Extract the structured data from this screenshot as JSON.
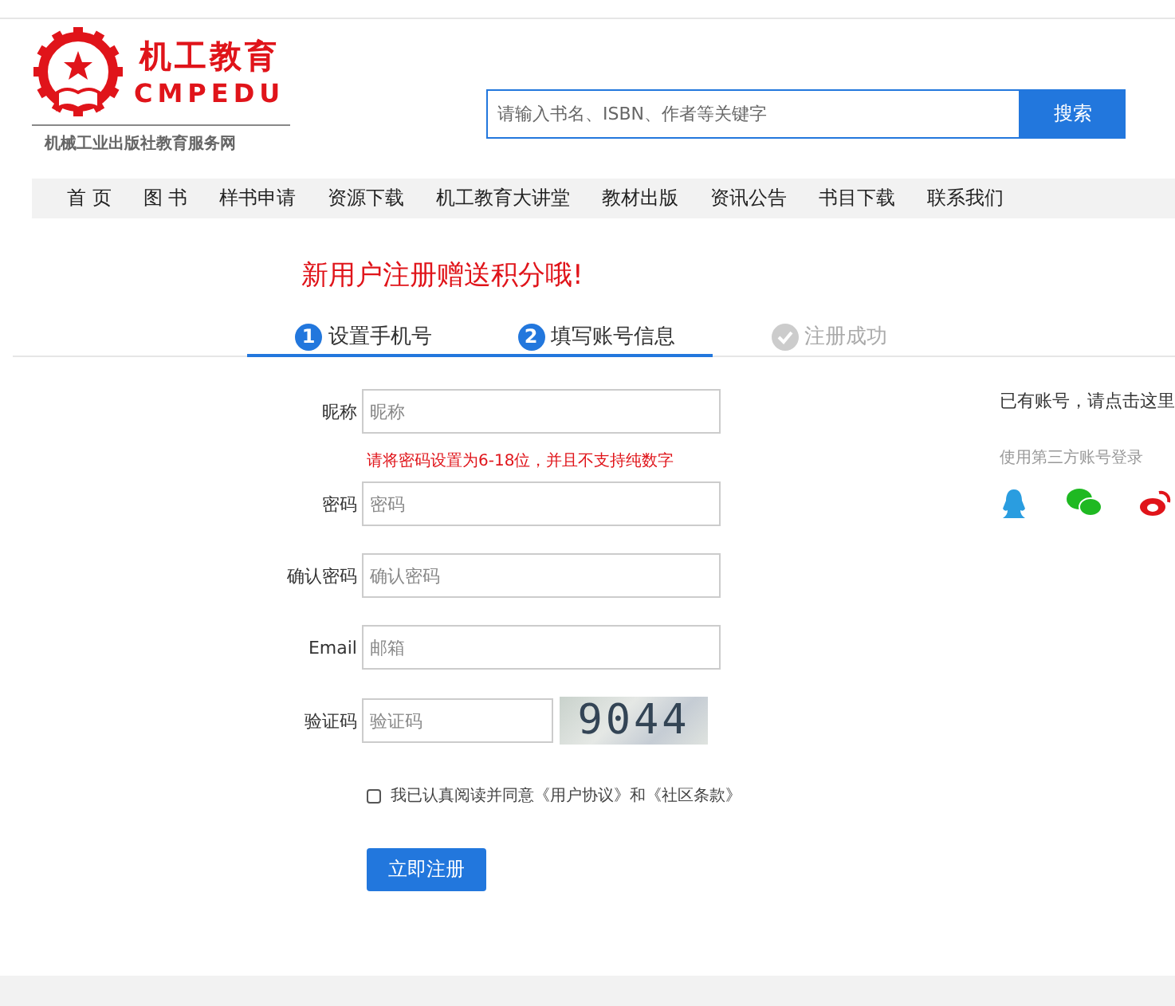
{
  "logo": {
    "title": "机工教育",
    "latin": "CMPEDU",
    "subtitle": "机械工业出版社教育服务网"
  },
  "search": {
    "placeholder": "请输入书名、ISBN、作者等关键字",
    "button": "搜索"
  },
  "nav": [
    "首 页",
    "图 书",
    "样书申请",
    "资源下载",
    "机工教育大讲堂",
    "教材出版",
    "资讯公告",
    "书目下载",
    "联系我们"
  ],
  "headline": "新用户注册赠送积分哦!",
  "steps": [
    {
      "kind": "number",
      "marker": "1",
      "label": "设置手机号",
      "done": true
    },
    {
      "kind": "number",
      "marker": "2",
      "label": "填写账号信息",
      "done": true
    },
    {
      "kind": "check",
      "label": "注册成功",
      "done": false
    }
  ],
  "fields": [
    {
      "label": "昵称",
      "placeholder": "昵称"
    },
    {
      "label": "密码",
      "placeholder": "密码",
      "hint": "请将密码设置为6-18位，并且不支持纯数字"
    },
    {
      "label": "确认密码",
      "placeholder": "确认密码"
    },
    {
      "label": "Email",
      "placeholder": "邮箱"
    },
    {
      "label": "验证码",
      "placeholder": "验证码",
      "captcha": "9044"
    }
  ],
  "agreement": {
    "checked": false,
    "text": "我已认真阅读并同意《用户协议》和《社区条款》"
  },
  "submit": "立即注册",
  "side": {
    "login_text": "已有账号，请点击这里",
    "third_party": "使用第三方账号登录"
  }
}
